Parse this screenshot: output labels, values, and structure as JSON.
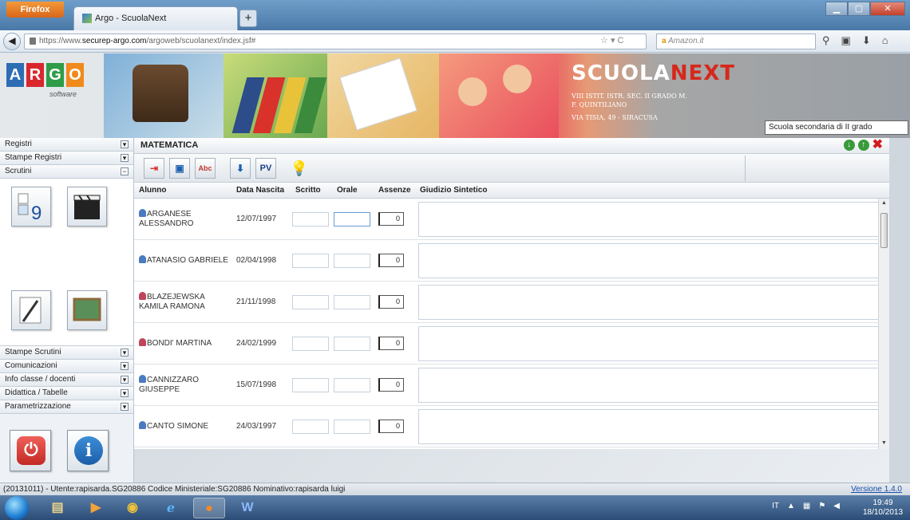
{
  "browser": {
    "menu_label": "Firefox",
    "tab_title": "Argo - ScuolaNext",
    "new_tab": "+",
    "url_prefix": "https://www.",
    "url_host": "securep-argo.com",
    "url_path": "/argoweb/scuolanext/index.jsf#",
    "search_engine": "a",
    "search_placeholder": "Amazon.it"
  },
  "banner": {
    "logo_letters": [
      "A",
      "R",
      "G",
      "O"
    ],
    "logo_colors": [
      "#2e6db4",
      "#d9272e",
      "#2e9c48",
      "#f08a1c"
    ],
    "logo_sub": "software",
    "product_main": "SCUOLA",
    "product_accent": "NEXT",
    "school_line1": "VIII ISTIT. ISTR. SEC. II GRADO M.",
    "school_line2": "F. QUINTILIANO",
    "school_addr": "VIA TISIA, 49 - SIRACUSA",
    "school_type": "Scuola secondaria di II grado"
  },
  "sidebar": {
    "top_items": [
      "Registri",
      "Stampe Registri",
      "Scrutini"
    ],
    "bottom_items": [
      "Stampe Scrutini",
      "Comunicazioni",
      "Info classe / docenti",
      "Didattica / Tabelle",
      "Parametrizzazione"
    ],
    "toggle": "−"
  },
  "main": {
    "title": "MATEMATICA",
    "columns": [
      "Alunno",
      "Data Nascita",
      "Scritto",
      "Orale",
      "Assenze",
      "Giudizio Sintetico"
    ],
    "toolbar_letters": "PV",
    "rows": [
      {
        "name": "ARGANESE ALESSANDRO",
        "date": "12/07/1997",
        "assenze": "0",
        "gender": "m"
      },
      {
        "name": "ATANASIO GABRIELE",
        "date": "02/04/1998",
        "assenze": "0",
        "gender": "m"
      },
      {
        "name": "BLAZEJEWSKA KAMILA RAMONA",
        "date": "21/11/1998",
        "assenze": "0",
        "gender": "f"
      },
      {
        "name": "BONDI' MARTINA",
        "date": "24/02/1999",
        "assenze": "0",
        "gender": "f"
      },
      {
        "name": "CANNIZZARO GIUSEPPE",
        "date": "15/07/1998",
        "assenze": "0",
        "gender": "m"
      },
      {
        "name": "CANTO SIMONE",
        "date": "24/03/1997",
        "assenze": "0",
        "gender": "m"
      }
    ]
  },
  "status": {
    "text": "(20131011) - Utente:rapisarda.SG20886 Codice Ministeriale:SG20886 Nominativo:rapisarda luigi",
    "version": "Versione 1.4.0"
  },
  "taskbar": {
    "lang": "IT",
    "time": "19:49",
    "date": "18/10/2013"
  },
  "colors": {
    "accent_red": "#d6281b",
    "green_ok": "#3a9a3a"
  }
}
